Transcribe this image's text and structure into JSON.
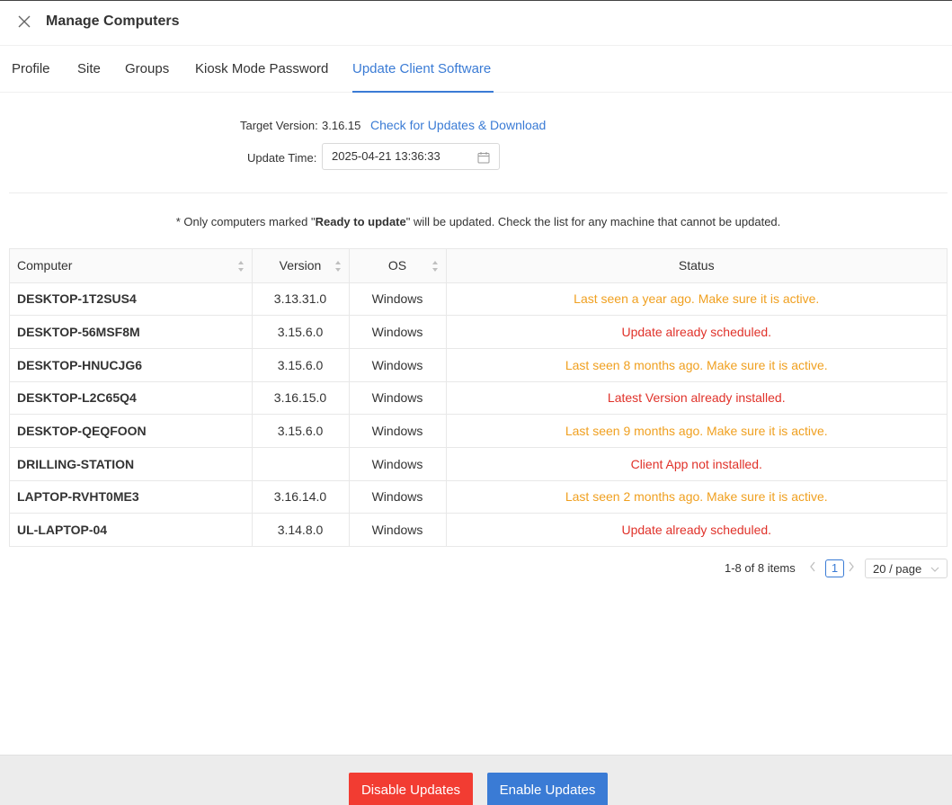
{
  "header": {
    "title": "Manage Computers",
    "close_icon": "close-icon"
  },
  "tabs": [
    {
      "label": "Profile",
      "active": false
    },
    {
      "label": "Site",
      "active": false
    },
    {
      "label": "Groups",
      "active": false
    },
    {
      "label": "Kiosk Mode Password",
      "active": false
    },
    {
      "label": "Update Client Software",
      "active": true
    }
  ],
  "form": {
    "target_version_label": "Target Version:",
    "target_version_value": "3.16.15",
    "check_updates_link": "Check for Updates & Download",
    "update_time_label": "Update Time:",
    "update_time_value": "2025-04-21 13:36:33",
    "calendar_icon": "calendar-icon"
  },
  "notice": {
    "prefix": "* Only computers marked \"",
    "emphasis": "Ready to update",
    "suffix": "\" will be updated. Check the list for any machine that cannot be updated."
  },
  "table": {
    "columns": [
      "Computer",
      "Version",
      "OS",
      "Status"
    ],
    "rows": [
      {
        "computer": "DESKTOP-1T2SUS4",
        "version": "3.13.31.0",
        "os": "Windows",
        "status": "Last seen a year ago. Make sure it is active.",
        "status_type": "warning"
      },
      {
        "computer": "DESKTOP-56MSF8M",
        "version": "3.15.6.0",
        "os": "Windows",
        "status": "Update already scheduled.",
        "status_type": "error"
      },
      {
        "computer": "DESKTOP-HNUCJG6",
        "version": "3.15.6.0",
        "os": "Windows",
        "status": "Last seen 8 months ago. Make sure it is active.",
        "status_type": "warning"
      },
      {
        "computer": "DESKTOP-L2C65Q4",
        "version": "3.16.15.0",
        "os": "Windows",
        "status": "Latest Version already installed.",
        "status_type": "error"
      },
      {
        "computer": "DESKTOP-QEQFOON",
        "version": "3.15.6.0",
        "os": "Windows",
        "status": "Last seen 9 months ago. Make sure it is active.",
        "status_type": "warning"
      },
      {
        "computer": "DRILLING-STATION",
        "version": "",
        "os": "Windows",
        "status": "Client App not installed.",
        "status_type": "error"
      },
      {
        "computer": "LAPTOP-RVHT0ME3",
        "version": "3.16.14.0",
        "os": "Windows",
        "status": "Last seen 2 months ago. Make sure it is active.",
        "status_type": "warning"
      },
      {
        "computer": "UL-LAPTOP-04",
        "version": "3.14.8.0",
        "os": "Windows",
        "status": "Update already scheduled.",
        "status_type": "error"
      }
    ]
  },
  "pagination": {
    "total_text": "1-8 of 8 items",
    "current_page": "1",
    "page_size": "20 / page"
  },
  "footer": {
    "disable_label": "Disable Updates",
    "enable_label": "Enable Updates"
  },
  "colors": {
    "accent": "#3a7bd5",
    "warning": "#f0a020",
    "error": "#e0322a",
    "danger_button": "#f23c32"
  }
}
